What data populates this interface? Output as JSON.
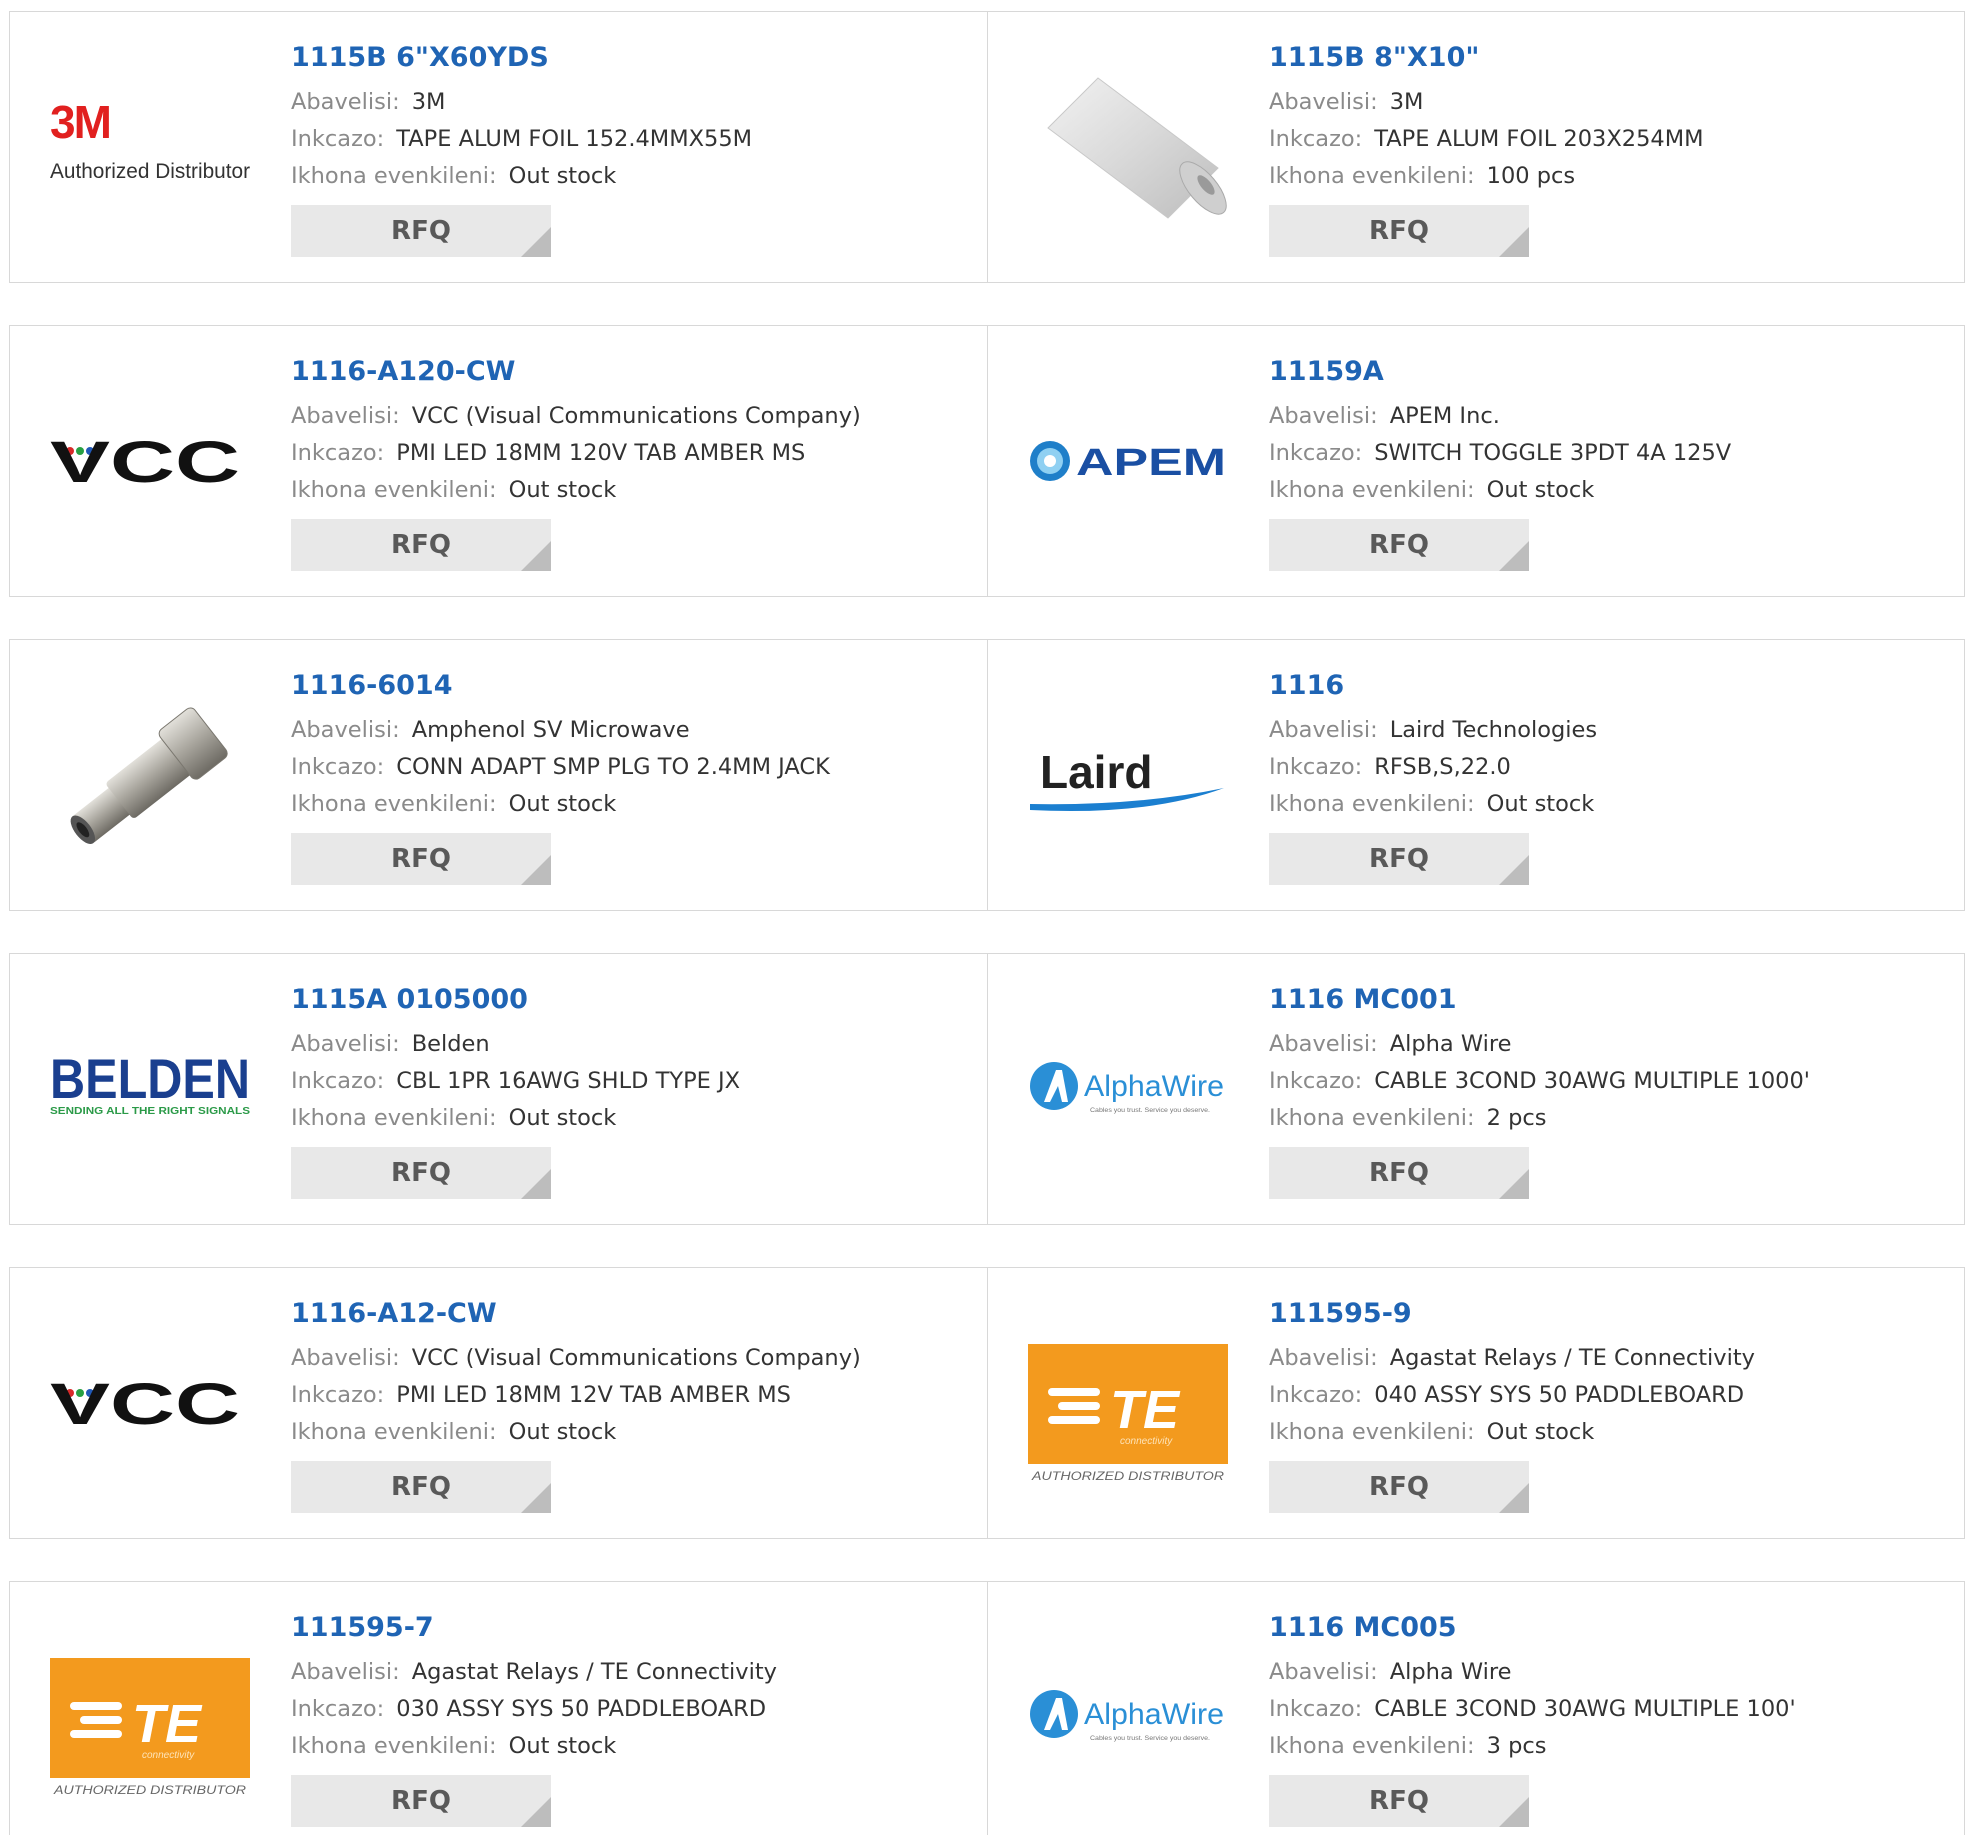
{
  "labels": {
    "manufacturer": "Abavelisi:",
    "description": "Inkcazo:",
    "stock": "Ikhona evenkileni:",
    "rfq": "RFQ"
  },
  "products": [
    {
      "part": "1115B 6\"X60YDS",
      "manufacturer": "3M",
      "description": "TAPE ALUM FOIL 152.4MMX55M",
      "stock": "Out stock",
      "logo": "3m-logo",
      "logo_caption": "Authorized Distributor",
      "logo_text": "3M"
    },
    {
      "part": "1115B 8\"X10\"",
      "manufacturer": "3M",
      "description": "TAPE ALUM FOIL 203X254MM",
      "stock": "100 pcs",
      "logo": "foil-roll-image"
    },
    {
      "part": "1116-A120-CW",
      "manufacturer": "VCC (Visual Communications Company)",
      "description": "PMI LED 18MM 120V TAB AMBER MS",
      "stock": "Out stock",
      "logo": "vcc-logo",
      "logo_text": "VCC"
    },
    {
      "part": "11159A",
      "manufacturer": "APEM Inc.",
      "description": "SWITCH TOGGLE 3PDT 4A 125V",
      "stock": "Out stock",
      "logo": "apem-logo",
      "logo_text": "APEM"
    },
    {
      "part": "1116-6014",
      "manufacturer": "Amphenol SV Microwave",
      "description": "CONN ADAPT SMP PLG TO 2.4MM JACK",
      "stock": "Out stock",
      "logo": "connector-adapter-image"
    },
    {
      "part": "1116",
      "manufacturer": "Laird Technologies",
      "description": "RFSB,S,22.0",
      "stock": "Out stock",
      "logo": "laird-logo",
      "logo_text": "Laird"
    },
    {
      "part": "1115A 0105000",
      "manufacturer": "Belden",
      "description": "CBL 1PR 16AWG SHLD TYPE JX",
      "stock": "Out stock",
      "logo": "belden-logo",
      "logo_text": "BELDEN",
      "logo_tagline": "SENDING ALL THE RIGHT SIGNALS"
    },
    {
      "part": "1116 MC001",
      "manufacturer": "Alpha Wire",
      "description": "CABLE 3COND 30AWG MULTIPLE 1000'",
      "stock": "2 pcs",
      "logo": "alphawire-logo",
      "logo_text": "AlphaWire",
      "logo_tagline": "Cables you trust. Service you deserve."
    },
    {
      "part": "1116-A12-CW",
      "manufacturer": "VCC (Visual Communications Company)",
      "description": "PMI LED 18MM 12V TAB AMBER MS",
      "stock": "Out stock",
      "logo": "vcc-logo",
      "logo_text": "VCC"
    },
    {
      "part": "111595-9",
      "manufacturer": "Agastat Relays / TE Connectivity",
      "description": "040 ASSY SYS 50 PADDLEBOARD",
      "stock": "Out stock",
      "logo": "te-logo",
      "logo_text": "TE",
      "logo_sub": "connectivity",
      "logo_caption": "AUTHORIZED DISTRIBUTOR"
    },
    {
      "part": "111595-7",
      "manufacturer": "Agastat Relays / TE Connectivity",
      "description": "030 ASSY SYS 50 PADDLEBOARD",
      "stock": "Out stock",
      "logo": "te-logo",
      "logo_text": "TE",
      "logo_sub": "connectivity",
      "logo_caption": "AUTHORIZED DISTRIBUTOR"
    },
    {
      "part": "1116 MC005",
      "manufacturer": "Alpha Wire",
      "description": "CABLE 3COND 30AWG MULTIPLE 100'",
      "stock": "3 pcs",
      "logo": "alphawire-logo",
      "logo_text": "AlphaWire",
      "logo_tagline": "Cables you trust. Service you deserve."
    }
  ],
  "colors": {
    "part_link": "#1f64b4",
    "label": "#8a8a8a",
    "value": "#333333",
    "rfq_bg": "#e8e8e8",
    "border": "#d8d8d8"
  }
}
